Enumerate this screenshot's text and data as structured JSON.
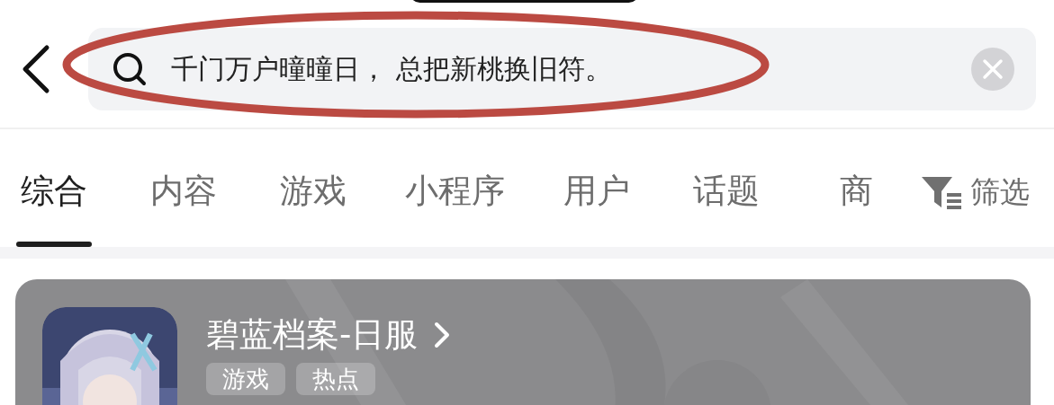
{
  "search": {
    "value": "千门万户曈曈日， 总把新桃换旧符。"
  },
  "tabs": [
    {
      "label": "综合",
      "selected": true
    },
    {
      "label": "内容",
      "selected": false
    },
    {
      "label": "游戏",
      "selected": false
    },
    {
      "label": "小程序",
      "selected": false
    },
    {
      "label": "用户",
      "selected": false
    },
    {
      "label": "话题",
      "selected": false
    },
    {
      "label": "商",
      "selected": false
    }
  ],
  "filter": {
    "label": "筛选"
  },
  "card": {
    "title": "碧蓝档案-日服",
    "tags": [
      "游戏",
      "热点"
    ]
  }
}
